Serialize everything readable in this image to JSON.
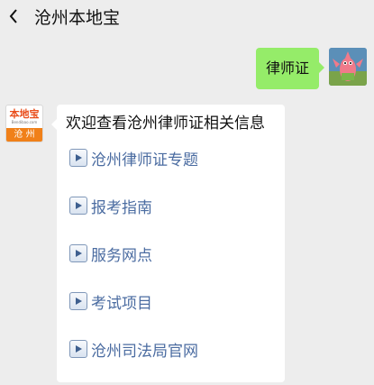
{
  "header": {
    "back_icon": "chevron-left-icon",
    "title": "沧州本地宝"
  },
  "conversation": {
    "user_message": "律师证",
    "bot": {
      "logo_text_top": "本地宝",
      "logo_text_url": "Bendibao.com",
      "logo_text_bottom": "沧 州",
      "greeting": "欢迎查看沧州律师证相关信息",
      "links": [
        {
          "label": "沧州律师证专题",
          "icon": "play-icon"
        },
        {
          "label": "报考指南",
          "icon": "play-icon"
        },
        {
          "label": "服务网点",
          "icon": "play-icon"
        },
        {
          "label": "考试项目",
          "icon": "play-icon"
        },
        {
          "label": "沧州司法局官网",
          "icon": "play-icon"
        }
      ]
    }
  },
  "colors": {
    "background": "#ededed",
    "user_bubble": "#95ec69",
    "link": "#4b6ca1",
    "logo_orange": "#f08019"
  }
}
